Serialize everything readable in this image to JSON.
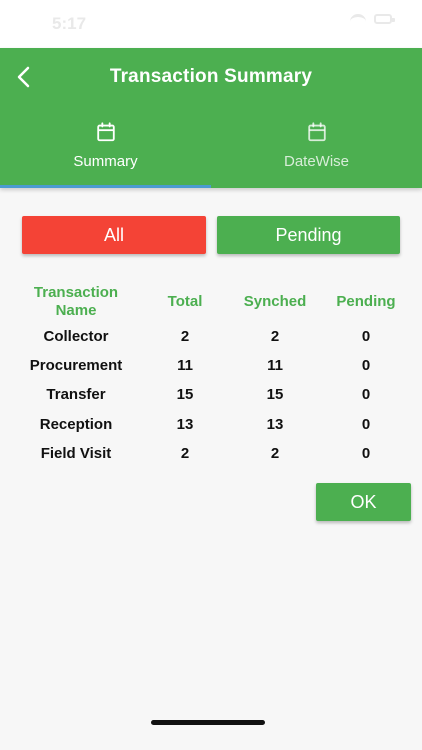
{
  "status_bar": {
    "time": "5:17"
  },
  "header": {
    "title": "Transaction Summary"
  },
  "tabs": [
    {
      "label": "Summary",
      "icon": "calendar-icon",
      "active": true
    },
    {
      "label": "DateWise",
      "icon": "calendar-icon",
      "active": false
    }
  ],
  "filters": {
    "all_label": "All",
    "pending_label": "Pending"
  },
  "table": {
    "headers": {
      "name": "Transaction Name",
      "total": "Total",
      "synched": "Synched",
      "pending": "Pending"
    },
    "rows": [
      {
        "name": "Collector",
        "total": "2",
        "synched": "2",
        "pending": "0"
      },
      {
        "name": "Procurement",
        "total": "11",
        "synched": "11",
        "pending": "0"
      },
      {
        "name": "Transfer",
        "total": "15",
        "synched": "15",
        "pending": "0"
      },
      {
        "name": "Reception",
        "total": "13",
        "synched": "13",
        "pending": "0"
      },
      {
        "name": "Field Visit",
        "total": "2",
        "synched": "2",
        "pending": "0"
      }
    ]
  },
  "actions": {
    "ok_label": "OK"
  },
  "colors": {
    "primary": "#4caf50",
    "danger": "#f44336",
    "tab_indicator": "#4b9bd0"
  }
}
